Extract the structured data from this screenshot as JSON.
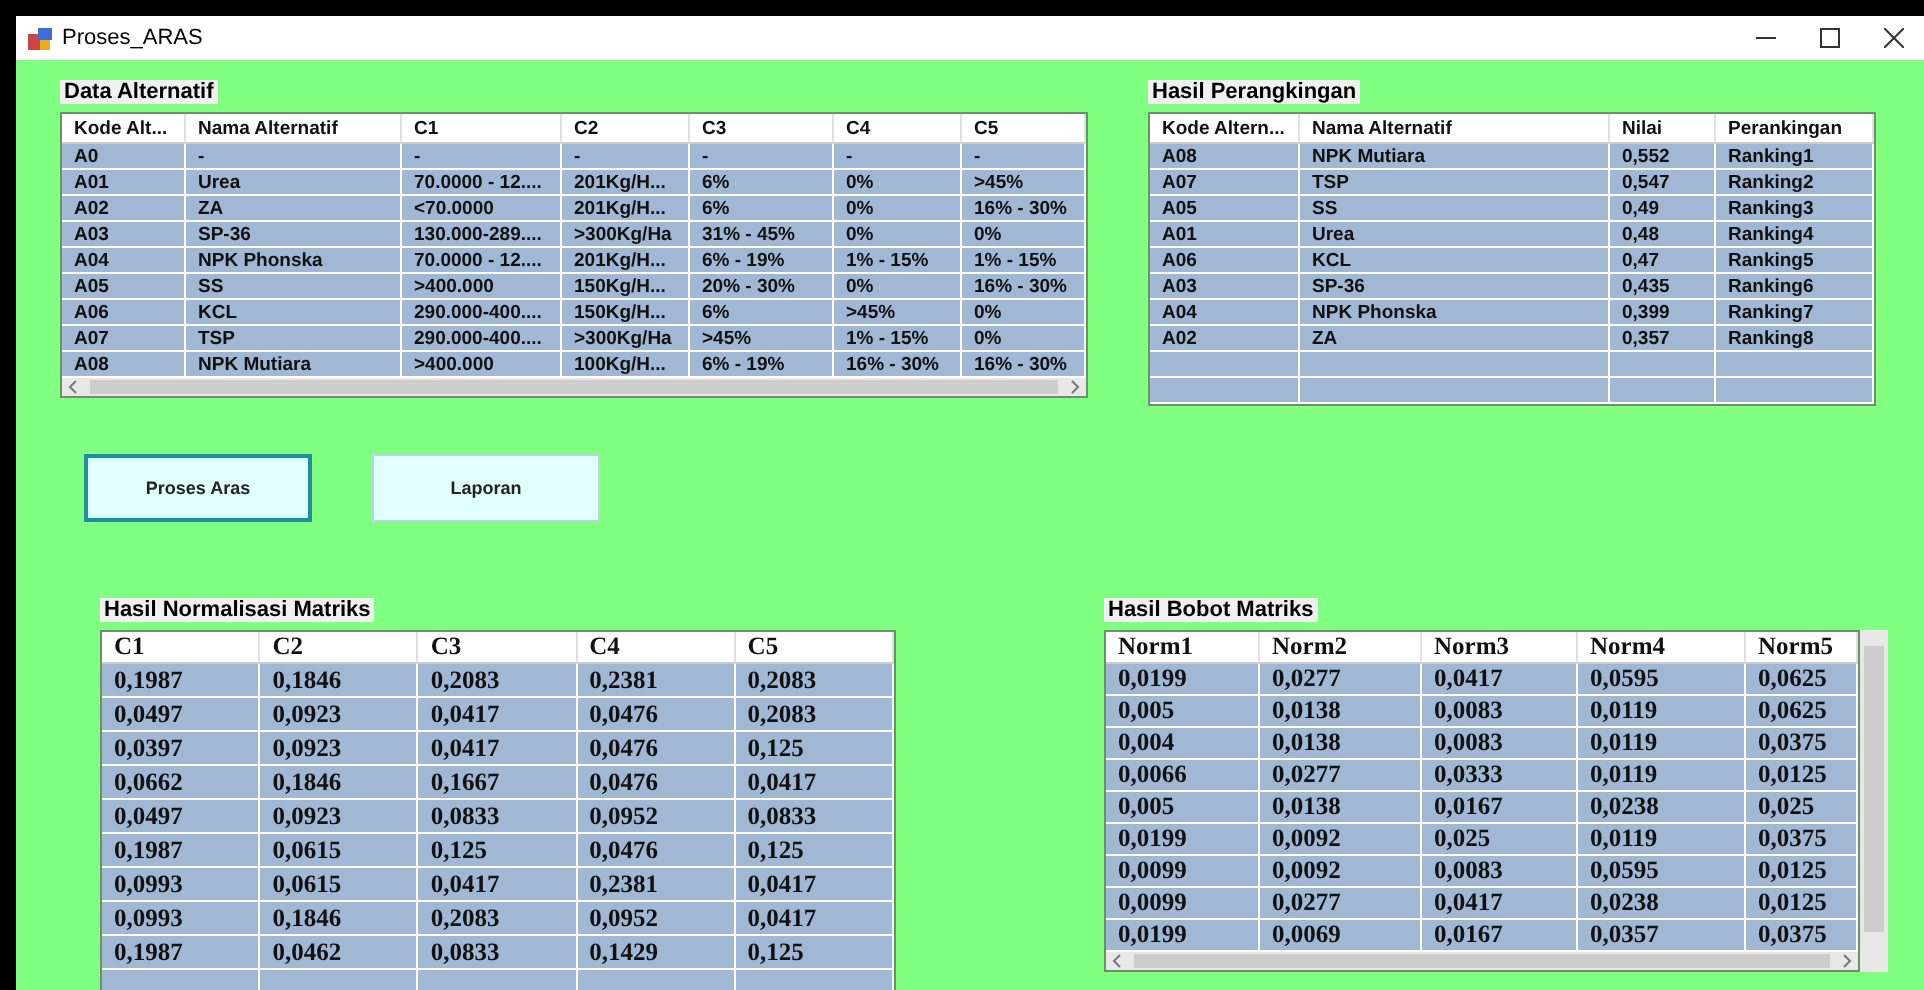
{
  "window": {
    "title": "Proses_ARAS"
  },
  "data_alternatif": {
    "title": "Data Alternatif",
    "columns": [
      "Kode Alt...",
      "Nama Alternatif",
      "C1",
      "C2",
      "C3",
      "C4",
      "C5"
    ],
    "rows": [
      [
        "A0",
        "-",
        "-",
        "-",
        "-",
        "-",
        "-"
      ],
      [
        "A01",
        "Urea",
        "70.0000 - 12....",
        "201Kg/H...",
        "6%",
        "0%",
        ">45%"
      ],
      [
        "A02",
        "ZA",
        "<70.0000",
        "201Kg/H...",
        "6%",
        "0%",
        "16% - 30%"
      ],
      [
        "A03",
        "SP-36",
        "130.000-289....",
        ">300Kg/Ha",
        "31% - 45%",
        "0%",
        "0%"
      ],
      [
        "A04",
        "NPK Phonska",
        "70.0000 - 12....",
        "201Kg/H...",
        "6% - 19%",
        "1% - 15%",
        "1% - 15%"
      ],
      [
        "A05",
        "SS",
        ">400.000",
        "150Kg/H...",
        "20% - 30%",
        "0%",
        "16% - 30%"
      ],
      [
        "A06",
        "KCL",
        "290.000-400....",
        "150Kg/H...",
        "6%",
        ">45%",
        "0%"
      ],
      [
        "A07",
        "TSP",
        "290.000-400....",
        ">300Kg/Ha",
        ">45%",
        "1% - 15%",
        "0%"
      ],
      [
        "A08",
        "NPK Mutiara",
        ">400.000",
        "100Kg/H...",
        "6% - 19%",
        "16% - 30%",
        "16% - 30%"
      ]
    ]
  },
  "hasil_perangkingan": {
    "title": "Hasil Perangkingan",
    "columns": [
      "Kode Altern...",
      "Nama Alternatif",
      "Nilai",
      "Perankingan"
    ],
    "rows": [
      [
        "A08",
        "NPK Mutiara",
        "0,552",
        "Ranking1"
      ],
      [
        "A07",
        "TSP",
        "0,547",
        "Ranking2"
      ],
      [
        "A05",
        "SS",
        "0,49",
        "Ranking3"
      ],
      [
        "A01",
        "Urea",
        "0,48",
        "Ranking4"
      ],
      [
        "A06",
        "KCL",
        "0,47",
        "Ranking5"
      ],
      [
        "A03",
        "SP-36",
        "0,435",
        "Ranking6"
      ],
      [
        "A04",
        "NPK Phonska",
        "0,399",
        "Ranking7"
      ],
      [
        "A02",
        "ZA",
        "0,357",
        "Ranking8"
      ]
    ]
  },
  "buttons": [
    {
      "label": "Proses Aras",
      "selected": true
    },
    {
      "label": "Laporan",
      "selected": false
    }
  ],
  "hasil_normalisasi": {
    "title": "Hasil Normalisasi Matriks",
    "columns": [
      "C1",
      "C2",
      "C3",
      "C4",
      "C5"
    ],
    "rows": [
      [
        "0,1987",
        "0,1846",
        "0,2083",
        "0,2381",
        "0,2083"
      ],
      [
        "0,0497",
        "0,0923",
        "0,0417",
        "0,0476",
        "0,2083"
      ],
      [
        "0,0397",
        "0,0923",
        "0,0417",
        "0,0476",
        "0,125"
      ],
      [
        "0,0662",
        "0,1846",
        "0,1667",
        "0,0476",
        "0,0417"
      ],
      [
        "0,0497",
        "0,0923",
        "0,0833",
        "0,0952",
        "0,0833"
      ],
      [
        "0,1987",
        "0,0615",
        "0,125",
        "0,0476",
        "0,125"
      ],
      [
        "0,0993",
        "0,0615",
        "0,0417",
        "0,2381",
        "0,0417"
      ],
      [
        "0,0993",
        "0,1846",
        "0,2083",
        "0,0952",
        "0,0417"
      ],
      [
        "0,1987",
        "0,0462",
        "0,0833",
        "0,1429",
        "0,125"
      ]
    ]
  },
  "hasil_bobot": {
    "title": "Hasil Bobot Matriks",
    "columns": [
      "Norm1",
      "Norm2",
      "Norm3",
      "Norm4",
      "Norm5"
    ],
    "rows": [
      [
        "0,0199",
        "0,0277",
        "0,0417",
        "0,0595",
        "0,0625"
      ],
      [
        "0,005",
        "0,0138",
        "0,0083",
        "0,0119",
        "0,0625"
      ],
      [
        "0,004",
        "0,0138",
        "0,0083",
        "0,0119",
        "0,0375"
      ],
      [
        "0,0066",
        "0,0277",
        "0,0333",
        "0,0119",
        "0,0125"
      ],
      [
        "0,005",
        "0,0138",
        "0,0167",
        "0,0238",
        "0,025"
      ],
      [
        "0,0199",
        "0,0092",
        "0,025",
        "0,0119",
        "0,0375"
      ],
      [
        "0,0099",
        "0,0092",
        "0,0083",
        "0,0595",
        "0,0125"
      ],
      [
        "0,0099",
        "0,0277",
        "0,0417",
        "0,0238",
        "0,0125"
      ],
      [
        "0,0199",
        "0,0069",
        "0,0167",
        "0,0357",
        "0,0375"
      ]
    ]
  }
}
